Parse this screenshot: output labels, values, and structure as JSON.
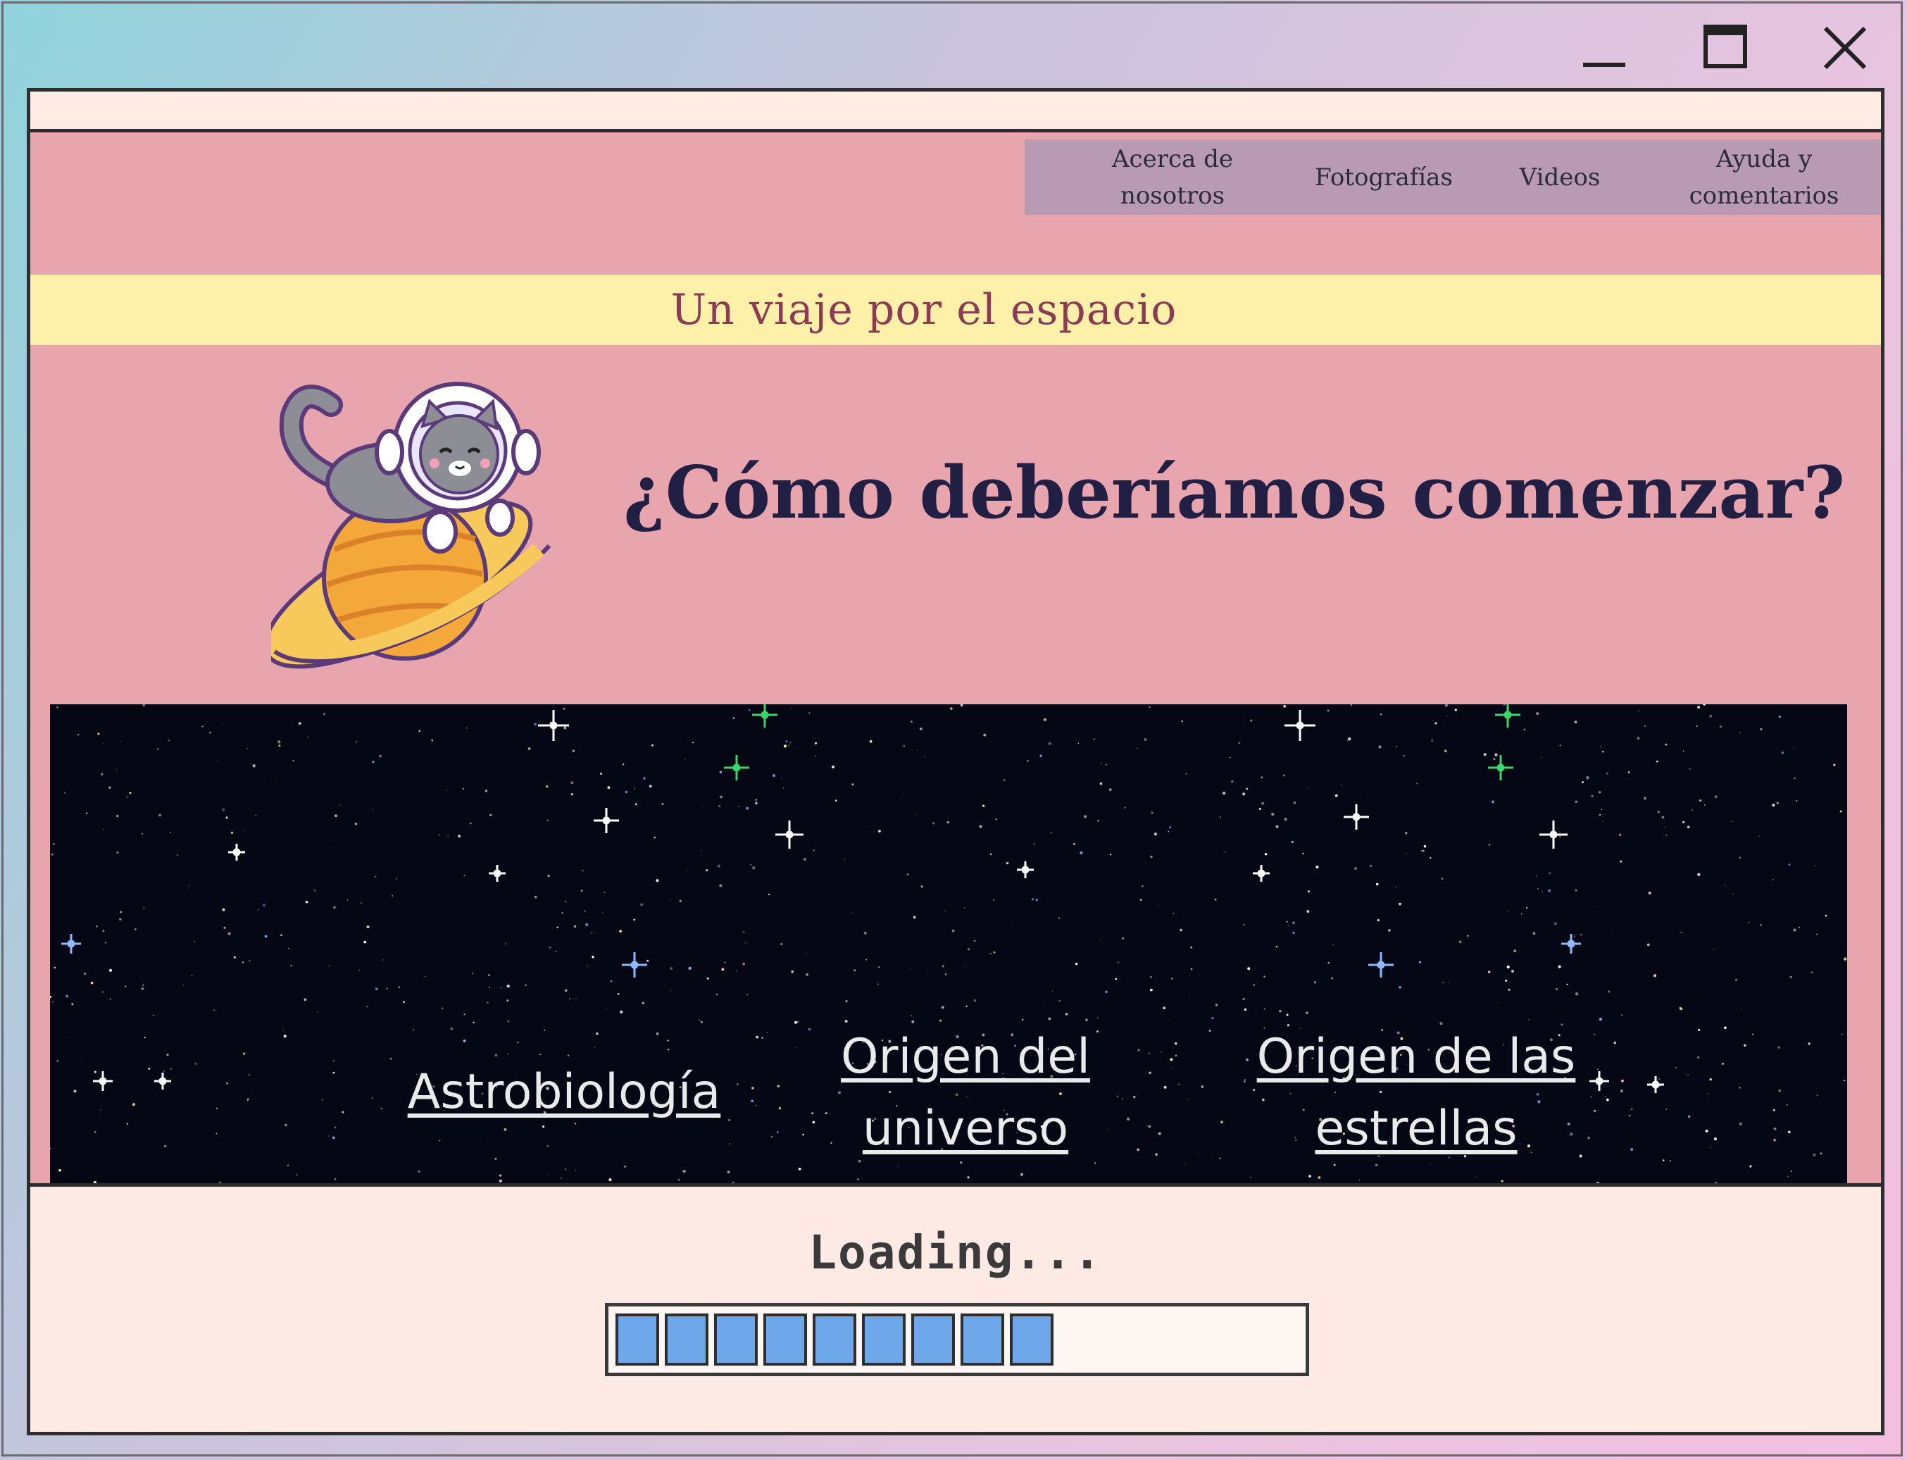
{
  "window": {
    "controls": {
      "minimize_icon": "minimize-icon",
      "maximize_icon": "maximize-icon",
      "close_icon": "close-icon"
    }
  },
  "nav": {
    "items": [
      {
        "line1": "Acerca de",
        "line2": "nosotros"
      },
      {
        "line1": "Fotografías",
        "line2": ""
      },
      {
        "line1": "Videos",
        "line2": ""
      },
      {
        "line1": "Ayuda y",
        "line2": "comentarios"
      }
    ]
  },
  "banner": {
    "title": "Un viaje por el espacio"
  },
  "hero": {
    "title": "¿Cómo deberíamos comenzar?",
    "mascot_icon": "astronaut-cat-on-planet-icon"
  },
  "links": {
    "astro": {
      "line1": "Astrobiología",
      "line2": ""
    },
    "universe": {
      "line1": "Origen del",
      "line2": "universo"
    },
    "stars": {
      "line1": "Origen de las",
      "line2": "estrellas"
    }
  },
  "loading": {
    "text": "Loading...",
    "progress_blocks": 9,
    "progress_fraction": 0.62
  },
  "colors": {
    "background_pink": "#e8a5ae",
    "banner_yellow": "#fdf0a8",
    "nav_purple": "#b89bb3",
    "title_navy": "#221f44",
    "progress_blue": "#6fa8ea"
  }
}
